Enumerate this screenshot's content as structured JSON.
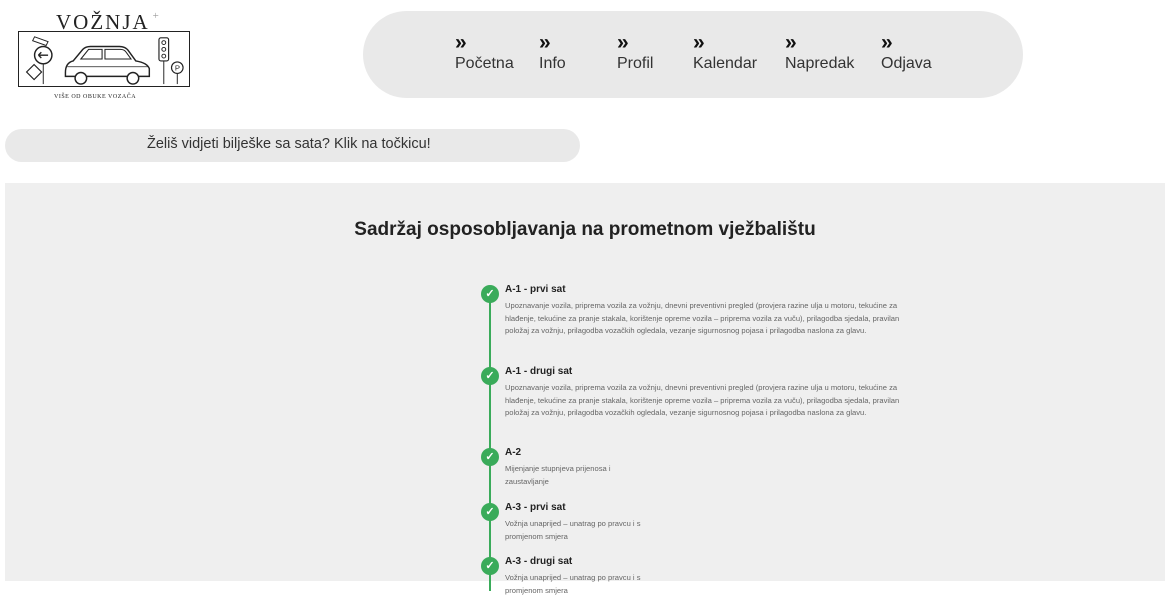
{
  "brand": {
    "title": "VOŽNJA",
    "plus": "+",
    "tagline": "VIŠE OD OBUKE VOZAČA"
  },
  "nav": {
    "items": [
      {
        "label": "Početna"
      },
      {
        "label": "Info"
      },
      {
        "label": "Profil"
      },
      {
        "label": "Kalendar"
      },
      {
        "label": "Napredak"
      },
      {
        "label": "Odjava"
      }
    ]
  },
  "notes_banner": {
    "text": "Želiš vidjeti bilješke sa sata? Klik na točkicu!"
  },
  "panel": {
    "title": "Sadržaj osposobljavanja na prometnom vježbalištu",
    "items": [
      {
        "title": "A-1 - prvi sat",
        "desc": "Upoznavanje vozila, priprema vozila za vožnju, dnevni preventivni pregled (provjera razine ulja u motoru, tekućine za hlađenje, tekućine za pranje stakala, korištenje opreme vozila – priprema vozila za vuču), prilagodba sjedala, pravilan položaj za vožnju, prilagodba vozačkih ogledala, vezanje sigurnosnog pojasa i prilagodba naslona za glavu."
      },
      {
        "title": "A-1 - drugi sat",
        "desc": "Upoznavanje vozila, priprema vozila za vožnju, dnevni preventivni pregled (provjera razine ulja u motoru, tekućine za hlađenje, tekućine za pranje stakala, korištenje opreme vozila – priprema vozila za vuču), prilagodba sjedala, pravilan položaj za vožnju, prilagodba vozačkih ogledala, vezanje sigurnosnog pojasa i prilagodba naslona za glavu."
      },
      {
        "title": "A-2",
        "desc": "Mijenjanje stupnjeva prijenosa i zaustavljanje"
      },
      {
        "title": "A-3 - prvi sat",
        "desc": "Vožnja unaprijed – unatrag po pravcu i s promjenom smjera"
      },
      {
        "title": "A-3 - drugi sat",
        "desc": "Vožnja unaprijed – unatrag po pravcu i s promjenom smjera"
      }
    ]
  },
  "colors": {
    "accent_green": "#3aab5a",
    "pill_gray": "#e9e9e9",
    "panel_gray": "#efefef"
  },
  "icons": {
    "nav_chevron": "double-chevron-right-icon",
    "timeline_check": "check-circle-icon"
  }
}
